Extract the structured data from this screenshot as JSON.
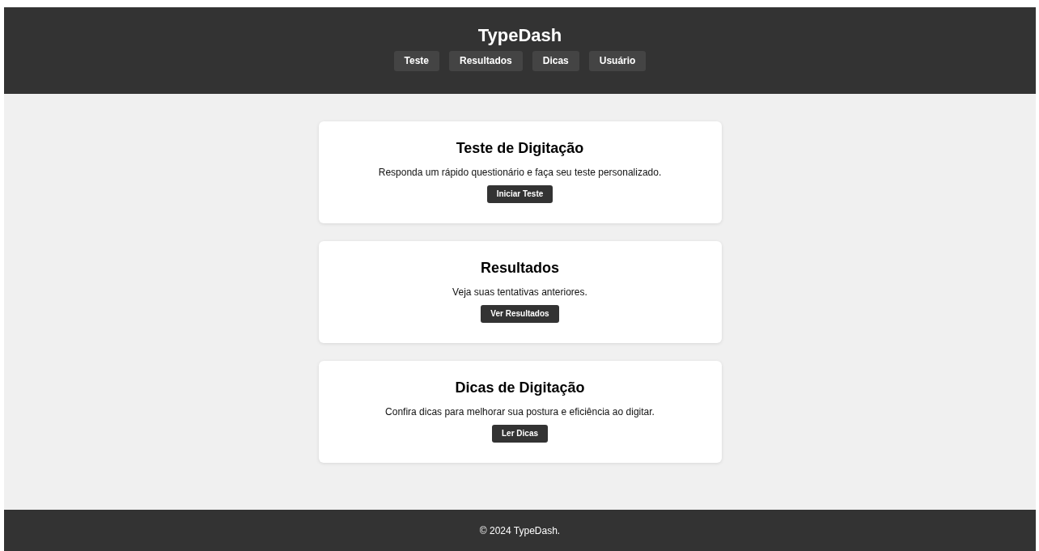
{
  "header": {
    "title": "TypeDash",
    "nav": [
      {
        "label": "Teste"
      },
      {
        "label": "Resultados"
      },
      {
        "label": "Dicas"
      },
      {
        "label": "Usuário"
      }
    ]
  },
  "cards": [
    {
      "title": "Teste de Digitação",
      "text": "Responda um rápido questionário e faça seu teste personalizado.",
      "button": "Iniciar Teste"
    },
    {
      "title": "Resultados",
      "text": "Veja suas tentativas anteriores.",
      "button": "Ver Resultados"
    },
    {
      "title": "Dicas de Digitação",
      "text": "Confira dicas para melhorar sua postura e eficiência ao digitar.",
      "button": "Ler Dicas"
    }
  ],
  "footer": {
    "text": "© 2024 TypeDash."
  }
}
